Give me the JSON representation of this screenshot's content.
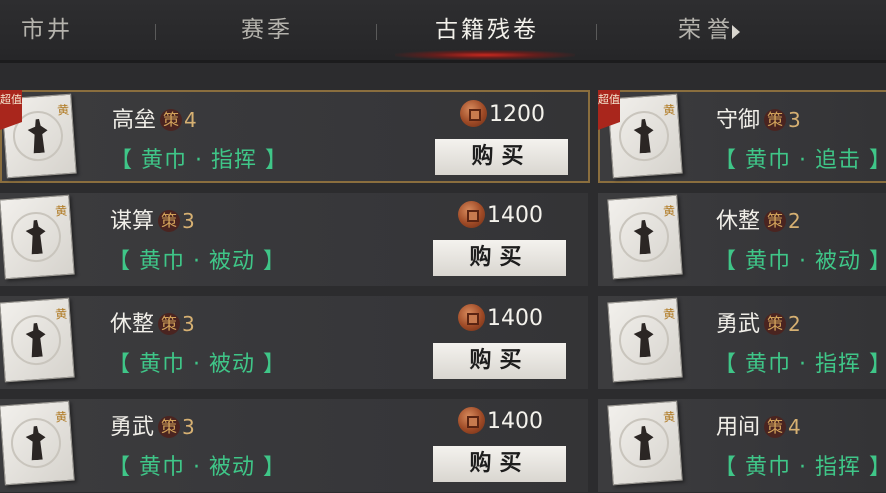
{
  "tabs": [
    {
      "label": "市井"
    },
    {
      "label": "赛季"
    },
    {
      "label": "古籍残卷",
      "active": true
    },
    {
      "label": "荣誉"
    }
  ],
  "items": [
    {
      "name": "高垒",
      "level": "4",
      "tags": "【 黄巾 · 指挥 】",
      "price": "1200",
      "buy": "购买",
      "special": "超值"
    },
    {
      "name": "谋算",
      "level": "3",
      "tags": "【 黄巾 · 被动 】",
      "price": "1400",
      "buy": "购买"
    },
    {
      "name": "休整",
      "level": "3",
      "tags": "【 黄巾 · 被动 】",
      "price": "1400",
      "buy": "购买"
    },
    {
      "name": "勇武",
      "level": "3",
      "tags": "【 黄巾 · 被动 】",
      "price": "1400",
      "buy": "购买"
    },
    {
      "name": "守御",
      "level": "3",
      "tags": "【 黄巾 · 追击 】",
      "special": "超值"
    },
    {
      "name": "休整",
      "level": "2",
      "tags": "【 黄巾 · 被动 】"
    },
    {
      "name": "勇武",
      "level": "2",
      "tags": "【 黄巾 · 指挥 】"
    },
    {
      "name": "用间",
      "level": "4",
      "tags": "【 黄巾 · 指挥 】"
    }
  ],
  "labels": {
    "badge": "策",
    "seal": "黄"
  },
  "colors": {
    "tag_green": "#3fc688",
    "highlight_border": "#8a6e3e",
    "ribbon_red": "#a9261c"
  }
}
